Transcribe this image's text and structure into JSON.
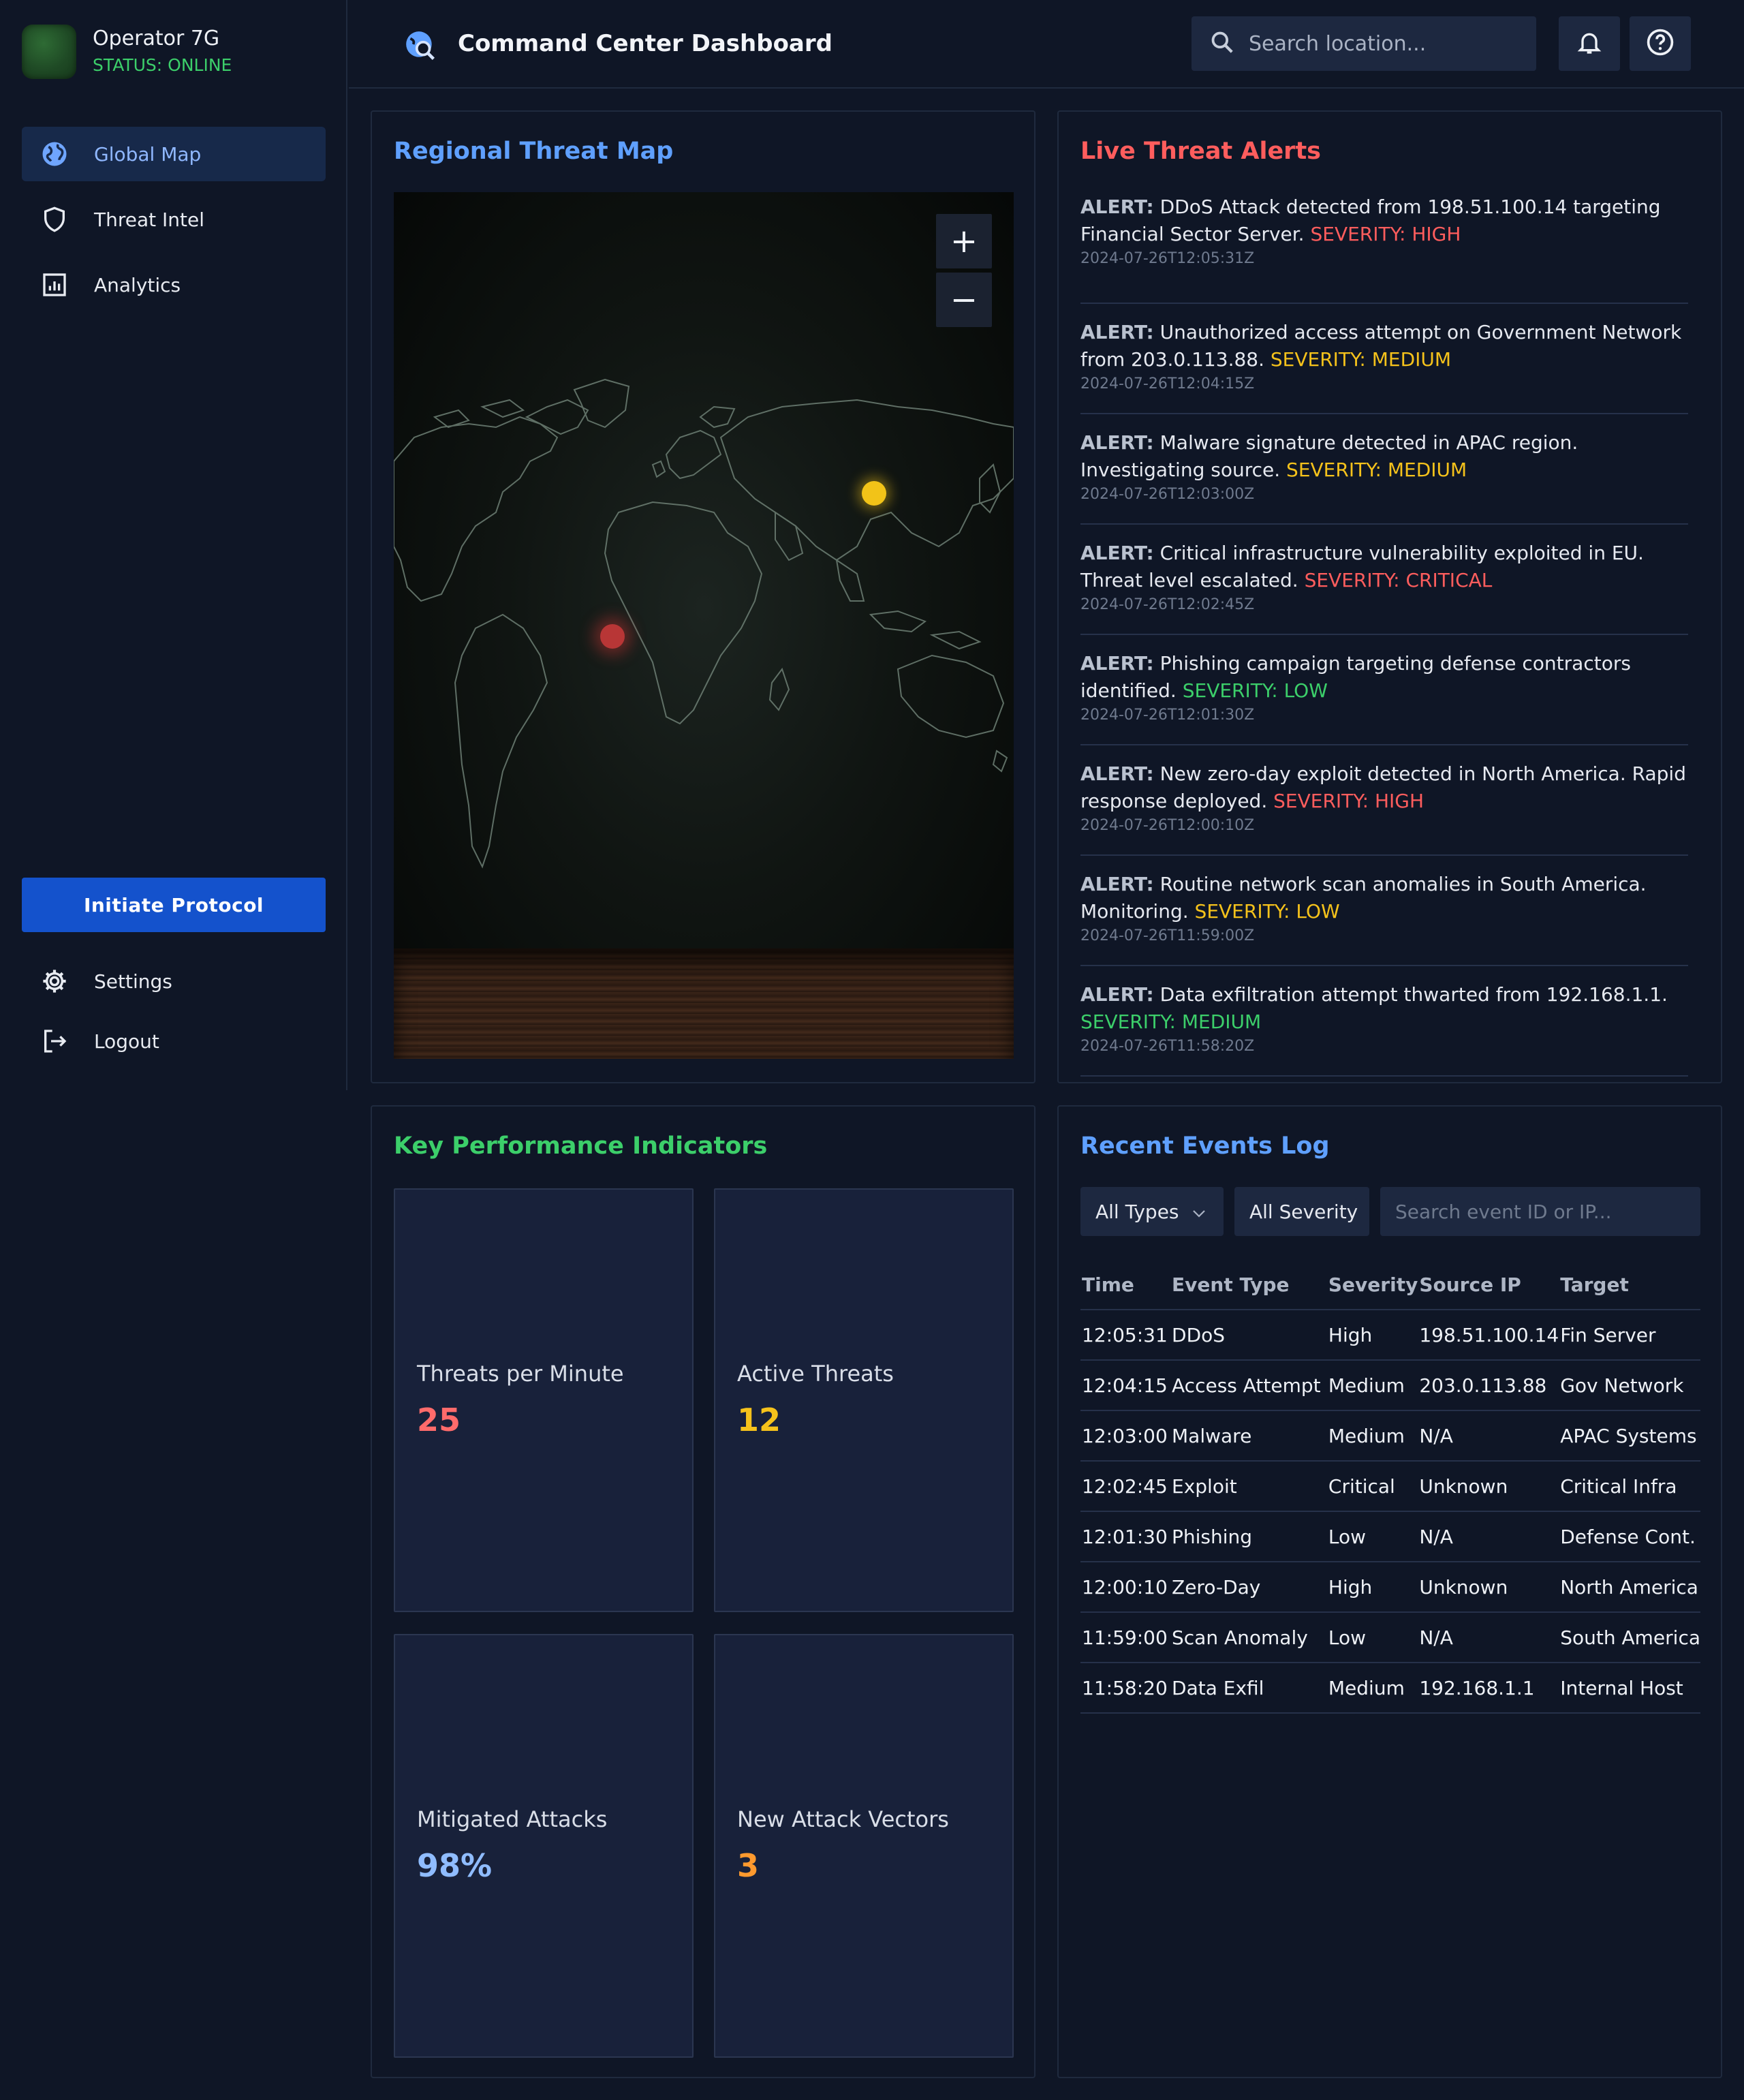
{
  "sidebar": {
    "operator_name": "Operator 7G",
    "status": "STATUS: ONLINE",
    "nav": [
      {
        "label": "Global Map",
        "icon": "globe-icon",
        "active": true
      },
      {
        "label": "Threat Intel",
        "icon": "shield-icon",
        "active": false
      },
      {
        "label": "Analytics",
        "icon": "chart-icon",
        "active": false
      }
    ],
    "protocol_button": "Initiate Protocol",
    "bottom_nav": [
      {
        "label": "Settings",
        "icon": "gear-icon"
      },
      {
        "label": "Logout",
        "icon": "logout-icon"
      }
    ]
  },
  "header": {
    "title": "Command Center Dashboard",
    "search_placeholder": "Search location...",
    "icons": [
      "globe-search-icon",
      "search-icon",
      "bell-icon",
      "help-icon"
    ]
  },
  "map_panel": {
    "title": "Regional Threat Map",
    "zoom_in": "+",
    "zoom_out": "−"
  },
  "alerts_panel": {
    "title": "Live Threat Alerts",
    "alerts": [
      {
        "prefix": "ALERT:",
        "text": "DDoS Attack detected from 198.51.100.14 targeting Financial Sector Server.",
        "severity": "SEVERITY: HIGH",
        "timestamp": "2024-07-26T12:05:31Z"
      },
      {
        "prefix": "ALERT:",
        "text": "Unauthorized access attempt on Government Network from 203.0.113.88.",
        "severity": "SEVERITY: MEDIUM",
        "timestamp": "2024-07-26T12:04:15Z"
      },
      {
        "prefix": "ALERT:",
        "text": "Malware signature detected in APAC region. Investigating source.",
        "severity": "SEVERITY: MEDIUM",
        "timestamp": "2024-07-26T12:03:00Z"
      },
      {
        "prefix": "ALERT:",
        "text": "Critical infrastructure vulnerability exploited in EU. Threat level escalated.",
        "severity": "SEVERITY: CRITICAL",
        "timestamp": "2024-07-26T12:02:45Z"
      },
      {
        "prefix": "ALERT:",
        "text": "Phishing campaign targeting defense contractors identified.",
        "severity": "SEVERITY: LOW",
        "timestamp": "2024-07-26T12:01:30Z"
      },
      {
        "prefix": "ALERT:",
        "text": "New zero-day exploit detected in North America. Rapid response deployed.",
        "severity": "SEVERITY: HIGH",
        "timestamp": "2024-07-26T12:00:10Z"
      },
      {
        "prefix": "ALERT:",
        "text": "Routine network scan anomalies in South America. Monitoring.",
        "severity": "SEVERITY: LOW",
        "timestamp": "2024-07-26T11:59:00Z"
      },
      {
        "prefix": "ALERT:",
        "text": "Data exfiltration attempt thwarted from 192.168.1.1.",
        "severity": "SEVERITY: MEDIUM",
        "timestamp": "2024-07-26T11:58:20Z"
      }
    ]
  },
  "kpi_panel": {
    "title": "Key Performance Indicators",
    "cards": [
      {
        "label": "Threats per Minute",
        "value": "25",
        "color": "#ff6b6b"
      },
      {
        "label": "Active Threats",
        "value": "12",
        "color": "#f5c21b"
      },
      {
        "label": "Mitigated Attacks",
        "value": "98%",
        "color": "#8fbcff"
      },
      {
        "label": "New Attack Vectors",
        "value": "3",
        "color": "#ff9a2e"
      }
    ]
  },
  "events_panel": {
    "title": "Recent Events Log",
    "filter_type": "All Types",
    "filter_severity": "All Severity",
    "search_placeholder": "Search event ID or IP...",
    "columns": [
      "Time",
      "Event Type",
      "Severity",
      "Source IP",
      "Target"
    ],
    "rows": [
      {
        "time": "12:05:31",
        "type": "DDoS",
        "severity": "High",
        "source": "198.51.100.14",
        "target": "Fin Server"
      },
      {
        "time": "12:04:15",
        "type": "Access Attempt",
        "severity": "Medium",
        "source": "203.0.113.88",
        "target": "Gov Network"
      },
      {
        "time": "12:03:00",
        "type": "Malware",
        "severity": "Medium",
        "source": "N/A",
        "target": "APAC Systems"
      },
      {
        "time": "12:02:45",
        "type": "Exploit",
        "severity": "Critical",
        "source": "Unknown",
        "target": "Critical Infra"
      },
      {
        "time": "12:01:30",
        "type": "Phishing",
        "severity": "Low",
        "source": "N/A",
        "target": "Defense Cont."
      },
      {
        "time": "12:00:10",
        "type": "Zero-Day",
        "severity": "High",
        "source": "Unknown",
        "target": "North America"
      },
      {
        "time": "11:59:00",
        "type": "Scan Anomaly",
        "severity": "Low",
        "source": "N/A",
        "target": "South America"
      },
      {
        "time": "11:58:20",
        "type": "Data Exfil",
        "severity": "Medium",
        "source": "192.168.1.1",
        "target": "Internal Host"
      }
    ]
  },
  "colors": {
    "accent_blue": "#5fa0ff",
    "alert_red": "#ff5d5d",
    "kpi_green": "#3ccf6a",
    "warning_amber": "#f5c21b",
    "primary_button": "#1452cc"
  }
}
